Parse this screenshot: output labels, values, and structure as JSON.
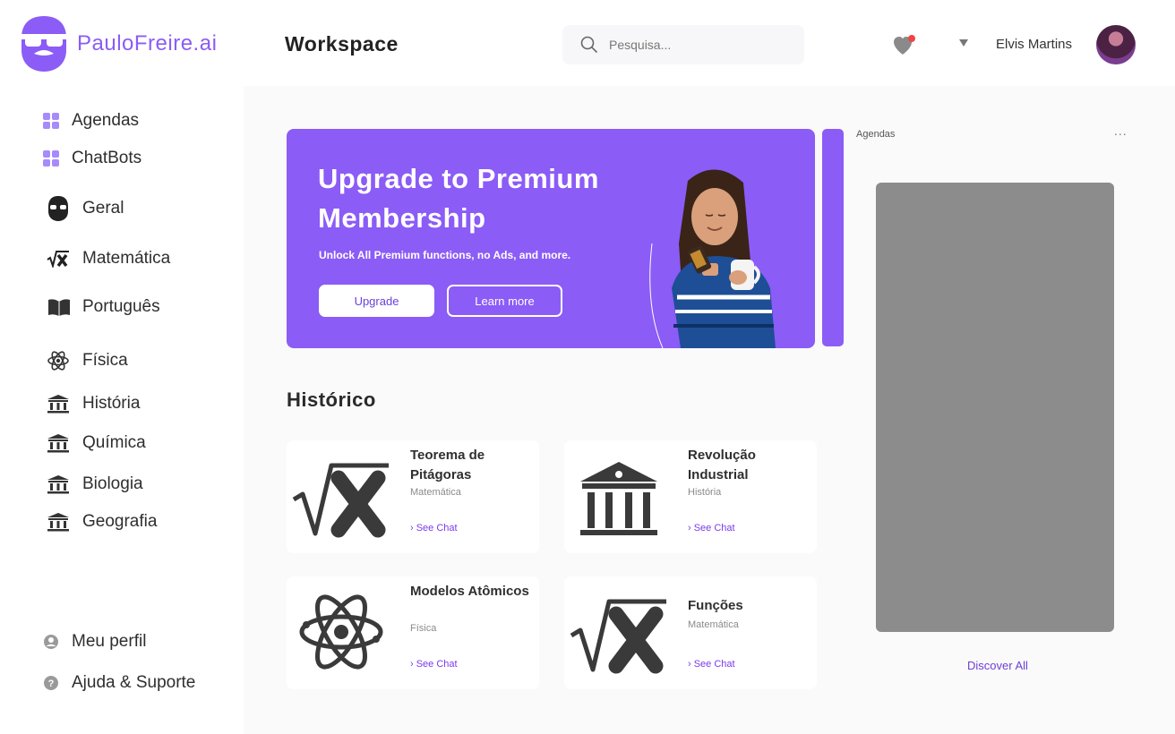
{
  "brand": {
    "name": "PauloFreire.ai",
    "accent": "#8b5cf6"
  },
  "sidebar": {
    "items": [
      {
        "label": "Agendas",
        "icon": "grid-icon"
      },
      {
        "label": "ChatBots",
        "icon": "grid-icon"
      },
      {
        "label": "Geral",
        "icon": "bearded-face-icon"
      },
      {
        "label": "Matemática",
        "icon": "square-root-x-icon"
      },
      {
        "label": "Português",
        "icon": "book-icon"
      },
      {
        "label": "Física",
        "icon": "atom-icon"
      },
      {
        "label": "História",
        "icon": "museum-icon"
      },
      {
        "label": "Química",
        "icon": "museum-icon"
      },
      {
        "label": "Biologia",
        "icon": "museum-icon"
      },
      {
        "label": "Geografia",
        "icon": "museum-icon"
      }
    ],
    "footer": [
      {
        "label": "Meu perfil",
        "icon": "user-circle-icon"
      },
      {
        "label": "Ajuda & Suporte",
        "icon": "help-icon"
      }
    ]
  },
  "header": {
    "title": "Workspace",
    "search_placeholder": "Pesquisa...",
    "user_name": "Elvis Martins",
    "notification_color": "#ef4444"
  },
  "banner": {
    "title": "Upgrade to Premium Membership",
    "subtitle": "Unlock All Premium functions, no Ads, and more.",
    "primary_button": "Upgrade",
    "secondary_button": "Learn more"
  },
  "history": {
    "title": "Histórico",
    "cards": [
      {
        "title": "Teorema de Pitágoras",
        "subject": "Matemática",
        "link": "› See Chat",
        "icon": "square-root-x-icon"
      },
      {
        "title": "Revolução Industrial",
        "subject": "História",
        "link": "› See Chat",
        "icon": "museum-icon"
      },
      {
        "title": "Modelos Atômicos",
        "subject": "Física",
        "link": "› See Chat",
        "icon": "atom-icon"
      },
      {
        "title": "Funções",
        "subject": "Matemática",
        "link": "› See Chat",
        "icon": "square-root-x-icon"
      }
    ]
  },
  "panel": {
    "title": "Agendas",
    "more": "...",
    "link": "Discover All"
  }
}
